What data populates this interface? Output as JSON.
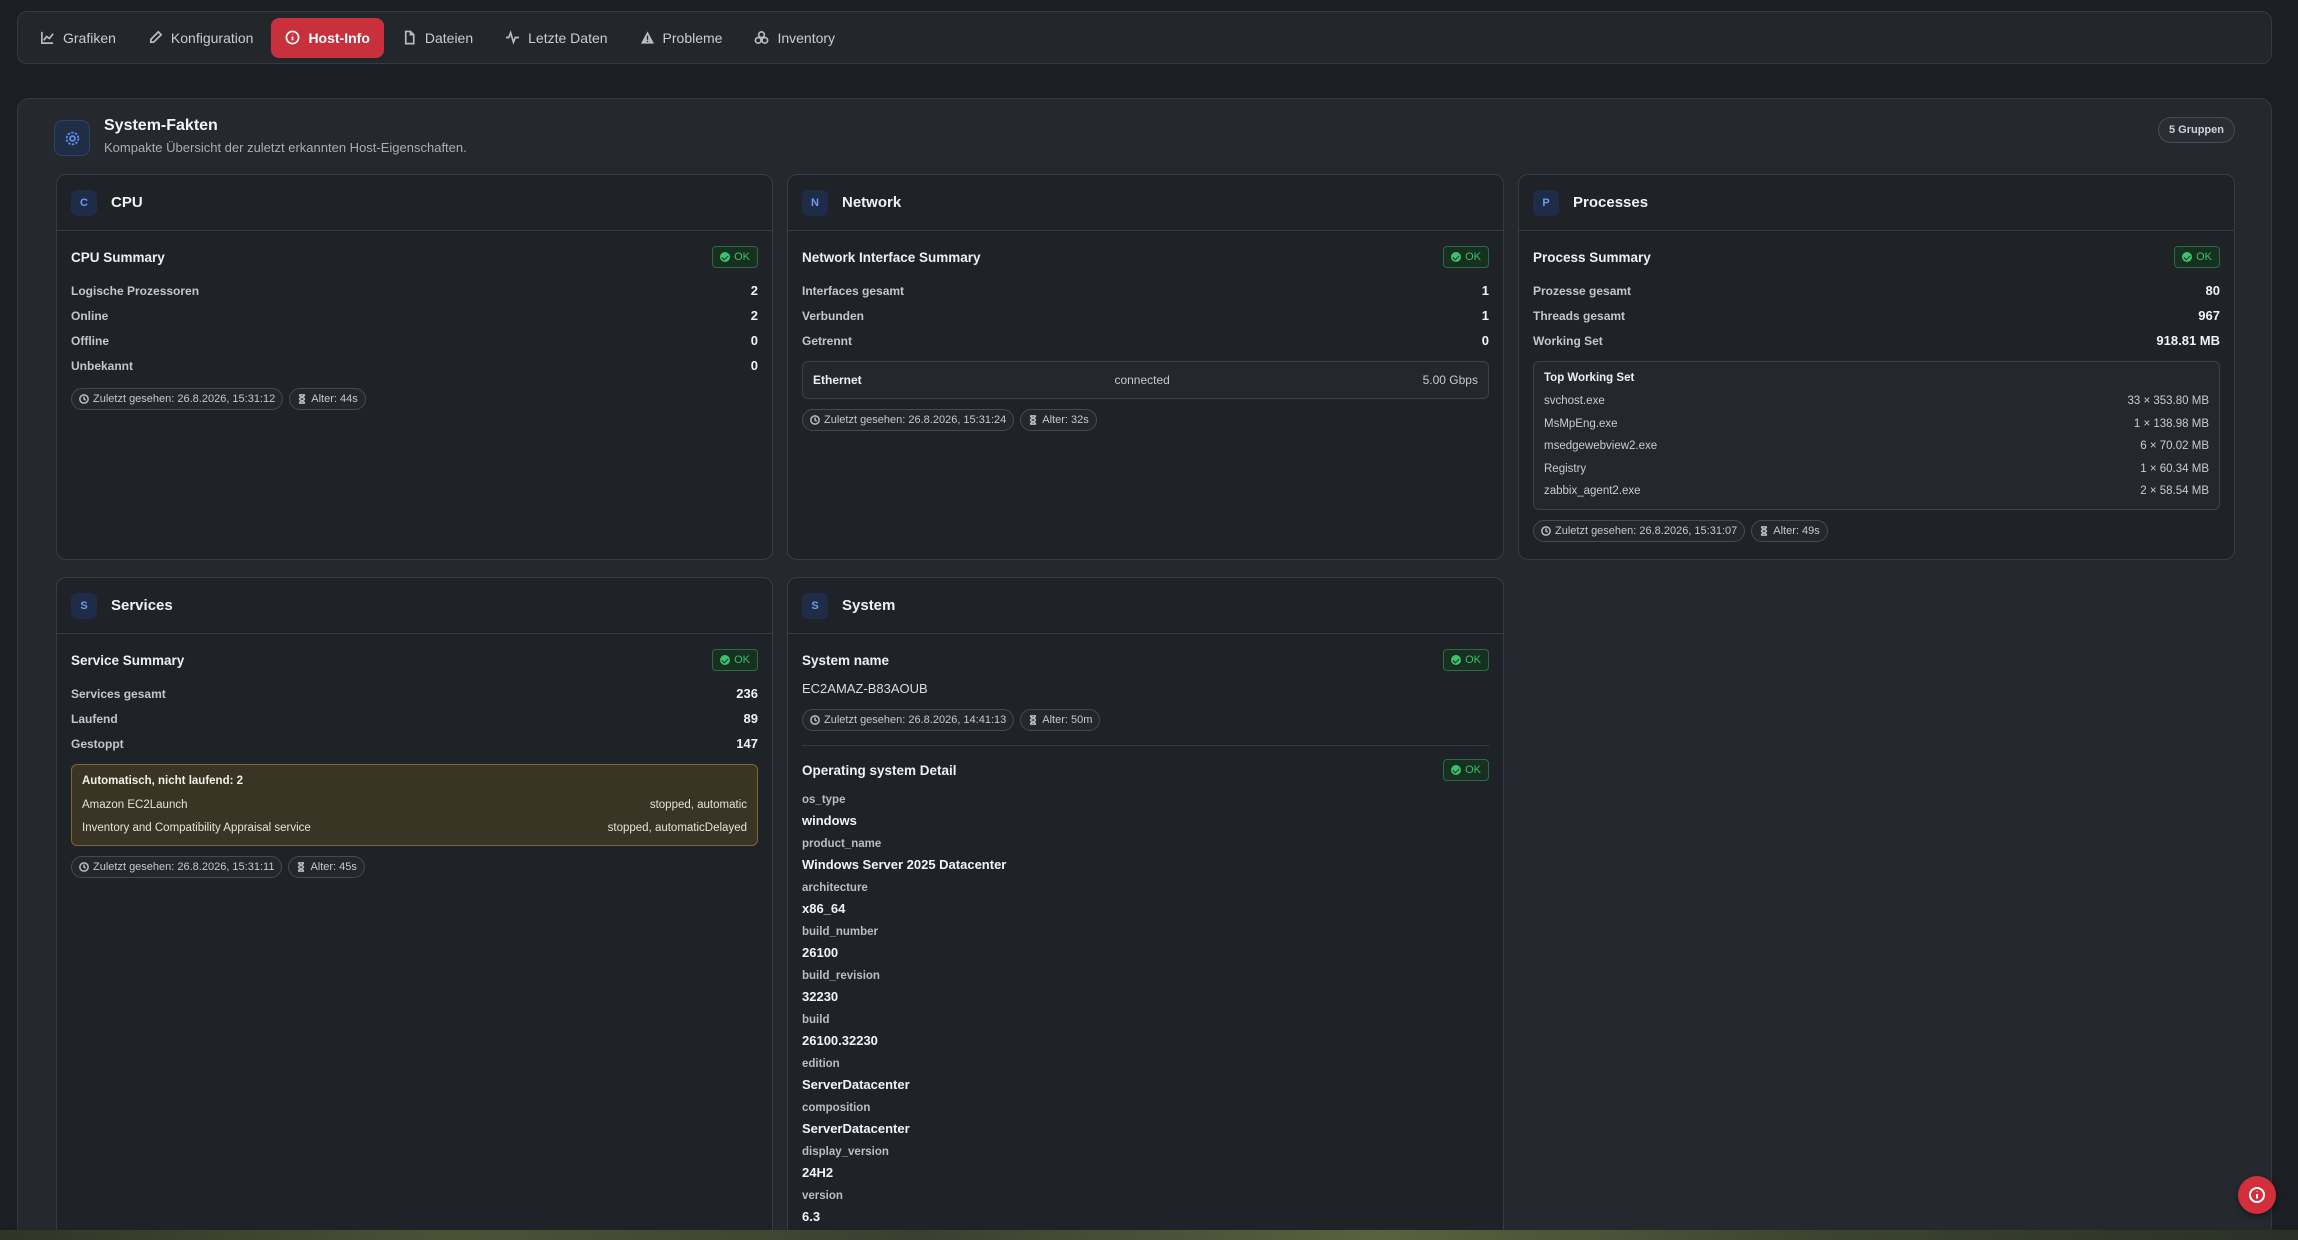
{
  "nav": {
    "tabs": [
      {
        "label": "Grafiken",
        "icon": "chart-line-icon"
      },
      {
        "label": "Konfiguration",
        "icon": "pencil-icon"
      },
      {
        "label": "Host-Info",
        "icon": "info-circle-icon",
        "active": true
      },
      {
        "label": "Dateien",
        "icon": "file-icon"
      },
      {
        "label": "Letzte Daten",
        "icon": "activity-icon"
      },
      {
        "label": "Probleme",
        "icon": "warning-icon"
      },
      {
        "label": "Inventory",
        "icon": "boxes-icon"
      }
    ]
  },
  "panel": {
    "title": "System-Fakten",
    "subtitle": "Kompakte Übersicht der zuletzt erkannten Host-Eigenschaften.",
    "group_count": "5 Gruppen"
  },
  "ok_label": "OK",
  "cpu": {
    "letter": "C",
    "title": "CPU",
    "section": "CPU Summary",
    "rows": [
      {
        "k": "Logische Prozessoren",
        "v": "2"
      },
      {
        "k": "Online",
        "v": "2"
      },
      {
        "k": "Offline",
        "v": "0"
      },
      {
        "k": "Unbekannt",
        "v": "0"
      }
    ],
    "last_seen": "Zuletzt gesehen: 26.8.2026, 15:31:12",
    "age": "Alter: 44s"
  },
  "network": {
    "letter": "N",
    "title": "Network",
    "section": "Network Interface Summary",
    "rows": [
      {
        "k": "Interfaces gesamt",
        "v": "1"
      },
      {
        "k": "Verbunden",
        "v": "1"
      },
      {
        "k": "Getrennt",
        "v": "0"
      }
    ],
    "interface": {
      "name": "Ethernet",
      "state": "connected",
      "speed": "5.00 Gbps"
    },
    "last_seen": "Zuletzt gesehen: 26.8.2026, 15:31:24",
    "age": "Alter: 32s"
  },
  "processes": {
    "letter": "P",
    "title": "Processes",
    "section": "Process Summary",
    "rows": [
      {
        "k": "Prozesse gesamt",
        "v": "80"
      },
      {
        "k": "Threads gesamt",
        "v": "967"
      },
      {
        "k": "Working Set",
        "v": "918.81 MB"
      }
    ],
    "top_title": "Top Working Set",
    "top": [
      {
        "name": "svchost.exe",
        "value": "33 × 353.80 MB"
      },
      {
        "name": "MsMpEng.exe",
        "value": "1 × 138.98 MB"
      },
      {
        "name": "msedgewebview2.exe",
        "value": "6 × 70.02 MB"
      },
      {
        "name": "Registry",
        "value": "1 × 60.34 MB"
      },
      {
        "name": "zabbix_agent2.exe",
        "value": "2 × 58.54 MB"
      }
    ],
    "last_seen": "Zuletzt gesehen: 26.8.2026, 15:31:07",
    "age": "Alter: 49s"
  },
  "services": {
    "letter": "S",
    "title": "Services",
    "section": "Service Summary",
    "rows": [
      {
        "k": "Services gesamt",
        "v": "236"
      },
      {
        "k": "Laufend",
        "v": "89"
      },
      {
        "k": "Gestoppt",
        "v": "147"
      }
    ],
    "warn_title": "Automatisch, nicht laufend: 2",
    "warn_rows": [
      {
        "name": "Amazon EC2Launch",
        "state": "stopped, automatic"
      },
      {
        "name": "Inventory and Compatibility Appraisal service",
        "state": "stopped, automaticDelayed"
      }
    ],
    "last_seen": "Zuletzt gesehen: 26.8.2026, 15:31:11",
    "age": "Alter: 45s"
  },
  "system": {
    "letter": "S",
    "title": "System",
    "name_section": "System name",
    "name_value": "EC2AMAZ-B83AOUB",
    "last_seen": "Zuletzt gesehen: 26.8.2026, 14:41:13",
    "age": "Alter: 50m",
    "os_section": "Operating system Detail",
    "attrs": [
      {
        "k": "os_type",
        "v": "windows"
      },
      {
        "k": "product_name",
        "v": "Windows Server 2025 Datacenter"
      },
      {
        "k": "architecture",
        "v": "x86_64"
      },
      {
        "k": "build_number",
        "v": "26100"
      },
      {
        "k": "build_revision",
        "v": "32230"
      },
      {
        "k": "build",
        "v": "26100.32230"
      },
      {
        "k": "edition",
        "v": "ServerDatacenter"
      },
      {
        "k": "composition",
        "v": "ServerDatacenter"
      },
      {
        "k": "display_version",
        "v": "24H2"
      },
      {
        "k": "version",
        "v": "6.3"
      }
    ]
  }
}
